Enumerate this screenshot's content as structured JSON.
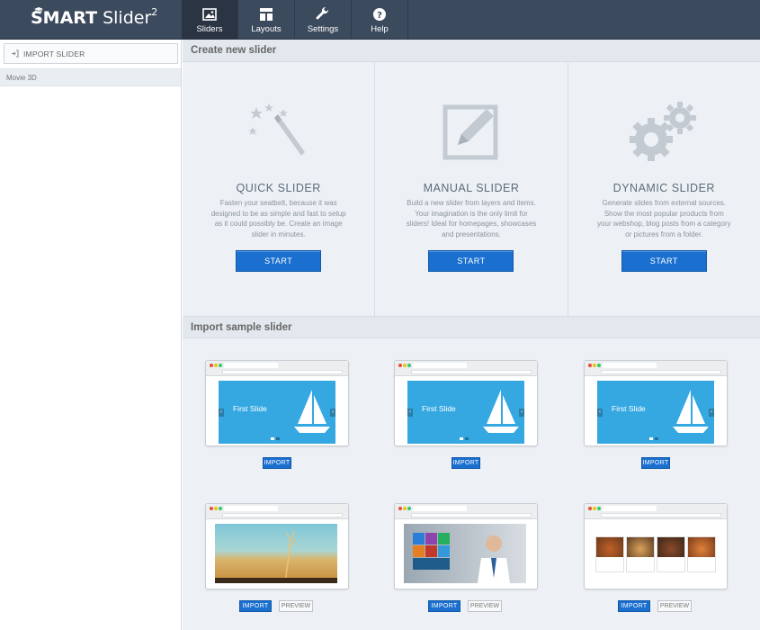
{
  "app": {
    "logo_main": "SMART",
    "logo_second": "Slider",
    "logo_sup": "2"
  },
  "nav": {
    "tabs": [
      {
        "label": "Sliders",
        "icon": "image-icon",
        "active": true
      },
      {
        "label": "Layouts",
        "icon": "layouts-icon",
        "active": false
      },
      {
        "label": "Settings",
        "icon": "wrench-icon",
        "active": false
      },
      {
        "label": "Help",
        "icon": "help-icon",
        "active": false
      }
    ]
  },
  "sidebar": {
    "import_label": "IMPORT SLIDER",
    "items": [
      {
        "label": "Movie 3D"
      }
    ]
  },
  "create": {
    "header": "Create new slider",
    "panels": [
      {
        "title": "QUICK SLIDER",
        "desc": "Fasten your seatbelt, because it was designed to be as simple and fast to setup as it could possibly be. Create an image slider in minutes.",
        "button": "START",
        "icon": "magic-wand-icon"
      },
      {
        "title": "MANUAL SLIDER",
        "desc": "Build a new slider from layers and items. Your imagination is the only limit for sliders! Ideal for homepages, showcases and presentations.",
        "button": "START",
        "icon": "edit-icon"
      },
      {
        "title": "DYNAMIC SLIDER",
        "desc": "Generate slides from external sources. Show the most popular products from your webshop, blog posts from a category or pictures from a folder.",
        "button": "START",
        "icon": "gears-icon"
      }
    ]
  },
  "samples": {
    "header": "Import sample slider",
    "slide_text": "First Slide",
    "import_label": "IMPORT",
    "preview_label": "PREVIEW"
  },
  "colors": {
    "topbar": "#3c4a5e",
    "accent": "#1a6fcf",
    "slide_blue": "#35a8e1"
  }
}
